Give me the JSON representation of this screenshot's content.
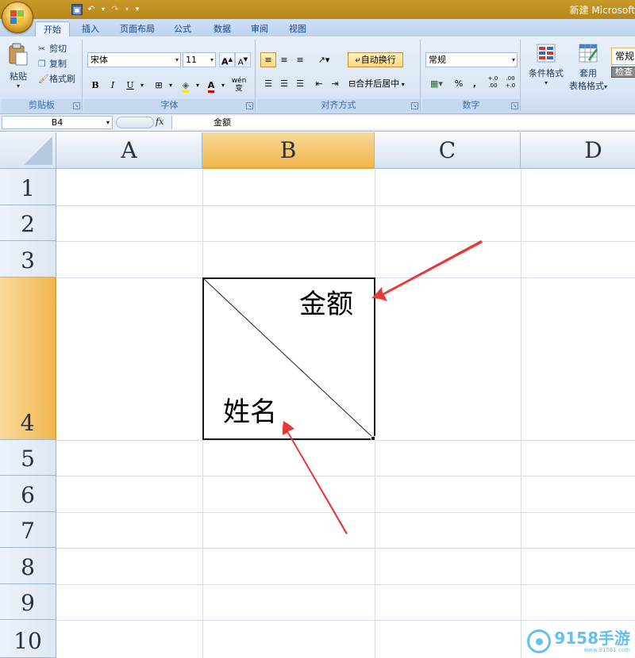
{
  "window": {
    "title": "新建 Microsoft"
  },
  "tabs": [
    {
      "label": "开始",
      "active": true
    },
    {
      "label": "插入"
    },
    {
      "label": "页面布局"
    },
    {
      "label": "公式"
    },
    {
      "label": "数据"
    },
    {
      "label": "审阅"
    },
    {
      "label": "视图"
    }
  ],
  "ribbon": {
    "clipboard": {
      "label": "剪贴板",
      "paste": "粘贴",
      "cut": "剪切",
      "copy": "复制",
      "format_painter": "格式刷"
    },
    "font": {
      "label": "字体",
      "name": "宋体",
      "size": "11",
      "bold": "B",
      "italic": "I",
      "underline": "U",
      "wen": "wén 变"
    },
    "alignment": {
      "label": "对齐方式",
      "wrap_text": "自动换行",
      "merge_center": "合并后居中"
    },
    "number": {
      "label": "数字",
      "format": "常规",
      "percent": "%",
      "comma": ",",
      "inc_decimal": "+.0 .00",
      "dec_decimal": ".00 +.0"
    },
    "styles": {
      "conditional": "条件格式",
      "table_format_1": "套用",
      "table_format_2": "表格格式",
      "style_normal": "常规",
      "style_check": "检查"
    }
  },
  "formula_bar": {
    "name_box": "B4",
    "fx": "fx",
    "content": "金额"
  },
  "sheet": {
    "columns": [
      "A",
      "B",
      "C",
      "D"
    ],
    "rows": [
      "1",
      "2",
      "3",
      "4",
      "5",
      "6",
      "7",
      "8",
      "9",
      "10"
    ],
    "cell_b4": {
      "top_right_text": "金额",
      "bottom_left_text": "姓名"
    }
  },
  "watermark": {
    "text": "9158手游",
    "url": "www.91581.com"
  },
  "colors": {
    "arrow": "#e53935",
    "selected_header": "#f3c46a",
    "ribbon": "#dbe7f6",
    "titlebar": "#c89a2a"
  }
}
